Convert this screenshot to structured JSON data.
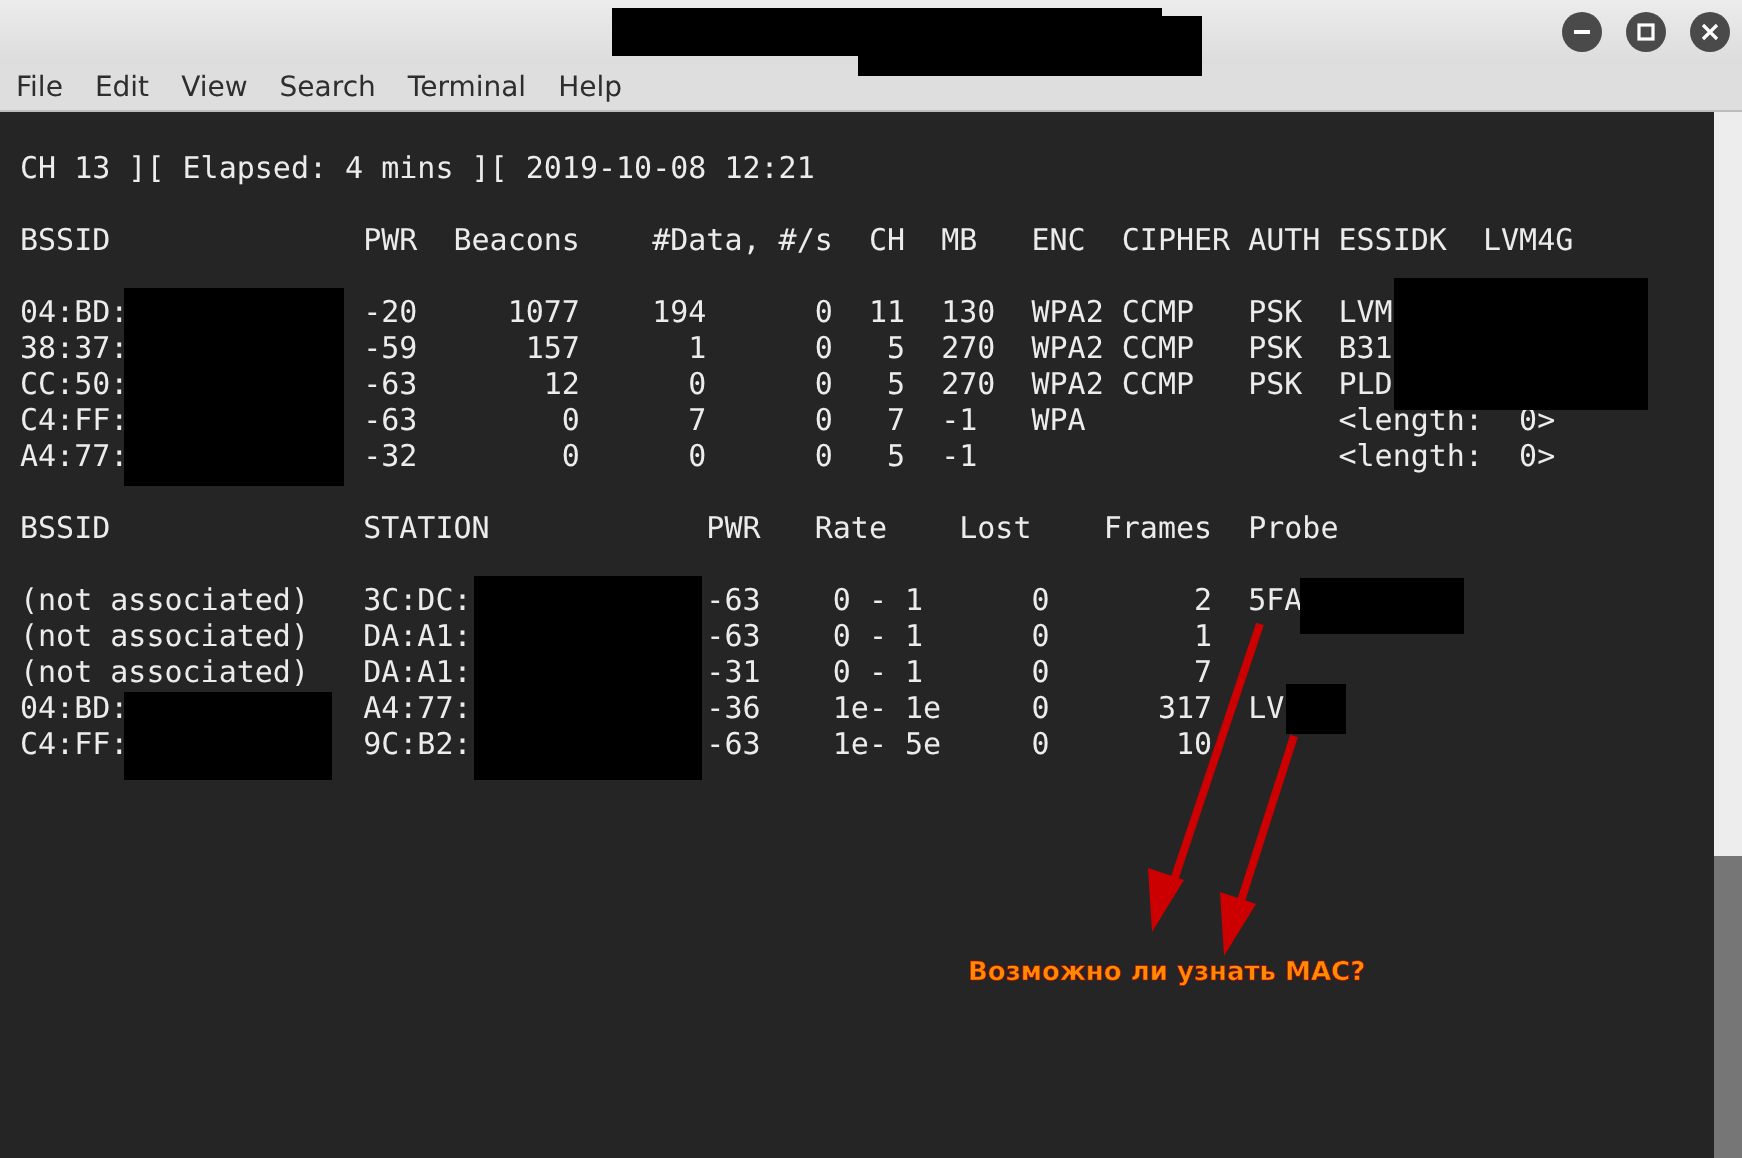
{
  "menu": [
    "File",
    "Edit",
    "View",
    "Search",
    "Terminal",
    "Help"
  ],
  "terminal": {
    "status_line": "CH 13 ][ Elapsed: 4 mins ][ 2019-10-08 12:21",
    "access_points": {
      "header": "BSSID              PWR  Beacons    #Data, #/s  CH  MB   ENC  CIPHER AUTH ESSIDK  LVM4G",
      "rows": [
        "04:BD:             -20     1077    194      0  11  130  WPA2 CCMP   PSK  LVM",
        "38:37:             -59      157      1      0   5  270  WPA2 CCMP   PSK  B31",
        "CC:50:             -63       12      0      0   5  270  WPA2 CCMP   PSK  PLD",
        "C4:FF:             -63        0      7      0   7  -1   WPA              <length:  0>",
        "A4:77:             -32        0      0      0   5  -1                    <length:  0>"
      ]
    },
    "stations": {
      "header": "BSSID              STATION            PWR   Rate    Lost    Frames  Probe",
      "rows": [
        "(not associated)   3C:DC:             -63    0 - 1      0        2  5FA",
        "(not associated)   DA:A1:             -63    0 - 1      0        1",
        "(not associated)   DA:A1:             -31    0 - 1      0        7",
        "04:BD:             A4:77:             -36    1e- 1e     0      317  LV",
        "C4:FF:             9C:B2:             -63    1e- 5e     0       10"
      ]
    }
  },
  "annotation": {
    "text": "Возможно ли узнать MAC?"
  }
}
